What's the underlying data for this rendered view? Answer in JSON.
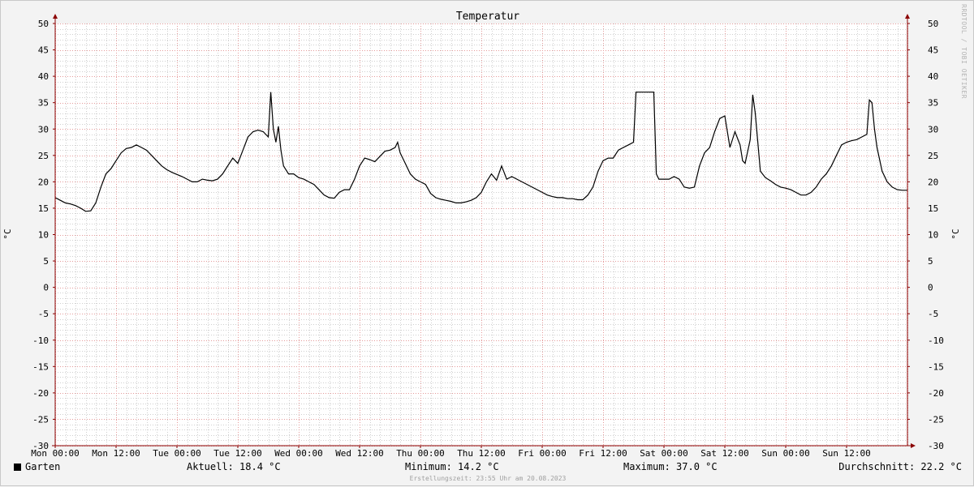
{
  "chart_data": {
    "type": "line",
    "title": "Temperatur",
    "ylabel_left": "°C",
    "ylabel_right": "°C",
    "ylim": [
      -30,
      50
    ],
    "ytick_step": 5,
    "xlim": [
      0,
      168
    ],
    "xticks": [
      {
        "h": 0,
        "label": "Mon 00:00"
      },
      {
        "h": 12,
        "label": "Mon 12:00"
      },
      {
        "h": 24,
        "label": "Tue 00:00"
      },
      {
        "h": 36,
        "label": "Tue 12:00"
      },
      {
        "h": 48,
        "label": "Wed 00:00"
      },
      {
        "h": 60,
        "label": "Wed 12:00"
      },
      {
        "h": 72,
        "label": "Thu 00:00"
      },
      {
        "h": 84,
        "label": "Thu 12:00"
      },
      {
        "h": 96,
        "label": "Fri 00:00"
      },
      {
        "h": 108,
        "label": "Fri 12:00"
      },
      {
        "h": 120,
        "label": "Sat 00:00"
      },
      {
        "h": 132,
        "label": "Sat 12:00"
      },
      {
        "h": 144,
        "label": "Sun 00:00"
      },
      {
        "h": 156,
        "label": "Sun 12:00"
      }
    ],
    "grid": true,
    "series": [
      {
        "name": "Garten",
        "color": "#000000",
        "points": [
          [
            0,
            17.0
          ],
          [
            1,
            16.5
          ],
          [
            2,
            16.0
          ],
          [
            3,
            15.8
          ],
          [
            4,
            15.5
          ],
          [
            5,
            15.0
          ],
          [
            6,
            14.4
          ],
          [
            7,
            14.5
          ],
          [
            8,
            16.0
          ],
          [
            9,
            19.0
          ],
          [
            10,
            21.5
          ],
          [
            11,
            22.5
          ],
          [
            12,
            24.0
          ],
          [
            13,
            25.5
          ],
          [
            14,
            26.3
          ],
          [
            15,
            26.5
          ],
          [
            16,
            27.0
          ],
          [
            17,
            26.5
          ],
          [
            18,
            26.0
          ],
          [
            19,
            25.0
          ],
          [
            20,
            24.0
          ],
          [
            21,
            23.0
          ],
          [
            22,
            22.3
          ],
          [
            23,
            21.8
          ],
          [
            24,
            21.4
          ],
          [
            25,
            21.0
          ],
          [
            26,
            20.5
          ],
          [
            27,
            20.0
          ],
          [
            28,
            20.0
          ],
          [
            29,
            20.5
          ],
          [
            30,
            20.3
          ],
          [
            31,
            20.2
          ],
          [
            32,
            20.5
          ],
          [
            33,
            21.5
          ],
          [
            34,
            23.0
          ],
          [
            35,
            24.5
          ],
          [
            36,
            23.5
          ],
          [
            37,
            26.0
          ],
          [
            38,
            28.5
          ],
          [
            39,
            29.5
          ],
          [
            40,
            29.8
          ],
          [
            41,
            29.5
          ],
          [
            42,
            28.5
          ],
          [
            42.5,
            37.0
          ],
          [
            43,
            30.0
          ],
          [
            43.5,
            27.5
          ],
          [
            44,
            30.5
          ],
          [
            44.5,
            26.0
          ],
          [
            45,
            23.0
          ],
          [
            46,
            21.5
          ],
          [
            47,
            21.5
          ],
          [
            48,
            20.8
          ],
          [
            49,
            20.5
          ],
          [
            50,
            20.0
          ],
          [
            51,
            19.5
          ],
          [
            52,
            18.5
          ],
          [
            53,
            17.5
          ],
          [
            54,
            17.0
          ],
          [
            55,
            16.9
          ],
          [
            56,
            18.0
          ],
          [
            57,
            18.5
          ],
          [
            58,
            18.5
          ],
          [
            59,
            20.5
          ],
          [
            60,
            23.0
          ],
          [
            61,
            24.5
          ],
          [
            62,
            24.2
          ],
          [
            63,
            23.8
          ],
          [
            64,
            24.8
          ],
          [
            65,
            25.8
          ],
          [
            66,
            26.0
          ],
          [
            67,
            26.5
          ],
          [
            67.5,
            27.5
          ],
          [
            68,
            25.5
          ],
          [
            69,
            23.5
          ],
          [
            70,
            21.5
          ],
          [
            71,
            20.5
          ],
          [
            72,
            20.0
          ],
          [
            73,
            19.5
          ],
          [
            74,
            17.8
          ],
          [
            75,
            17.0
          ],
          [
            76,
            16.7
          ],
          [
            77,
            16.5
          ],
          [
            78,
            16.3
          ],
          [
            79,
            16.0
          ],
          [
            80,
            16.0
          ],
          [
            81,
            16.2
          ],
          [
            82,
            16.5
          ],
          [
            83,
            17.0
          ],
          [
            84,
            18.0
          ],
          [
            85,
            20.0
          ],
          [
            86,
            21.5
          ],
          [
            87,
            20.3
          ],
          [
            88,
            23.0
          ],
          [
            89,
            20.5
          ],
          [
            90,
            21.0
          ],
          [
            91,
            20.5
          ],
          [
            92,
            20.0
          ],
          [
            93,
            19.5
          ],
          [
            94,
            19.0
          ],
          [
            95,
            18.5
          ],
          [
            96,
            18.0
          ],
          [
            97,
            17.5
          ],
          [
            98,
            17.2
          ],
          [
            99,
            17.0
          ],
          [
            100,
            17.0
          ],
          [
            101,
            16.8
          ],
          [
            102,
            16.8
          ],
          [
            103,
            16.6
          ],
          [
            104,
            16.6
          ],
          [
            105,
            17.5
          ],
          [
            106,
            19.0
          ],
          [
            107,
            22.0
          ],
          [
            108,
            24.0
          ],
          [
            109,
            24.5
          ],
          [
            110,
            24.5
          ],
          [
            111,
            26.0
          ],
          [
            112,
            26.5
          ],
          [
            113,
            27.0
          ],
          [
            114,
            27.5
          ],
          [
            114.5,
            37.0
          ],
          [
            118,
            37.0
          ],
          [
            118.5,
            21.5
          ],
          [
            119,
            20.5
          ],
          [
            120,
            20.5
          ],
          [
            121,
            20.5
          ],
          [
            122,
            21.0
          ],
          [
            123,
            20.5
          ],
          [
            124,
            19.0
          ],
          [
            125,
            18.8
          ],
          [
            126,
            19.0
          ],
          [
            127,
            23.0
          ],
          [
            128,
            25.5
          ],
          [
            129,
            26.5
          ],
          [
            130,
            29.5
          ],
          [
            131,
            32.0
          ],
          [
            132,
            32.5
          ],
          [
            133,
            26.5
          ],
          [
            134,
            29.5
          ],
          [
            135,
            27.0
          ],
          [
            135.5,
            24.0
          ],
          [
            136,
            23.5
          ],
          [
            137,
            28.0
          ],
          [
            137.5,
            36.5
          ],
          [
            138,
            33.0
          ],
          [
            139,
            22.0
          ],
          [
            140,
            20.8
          ],
          [
            141,
            20.2
          ],
          [
            142,
            19.5
          ],
          [
            143,
            19.0
          ],
          [
            144,
            18.8
          ],
          [
            145,
            18.5
          ],
          [
            146,
            18.0
          ],
          [
            147,
            17.5
          ],
          [
            148,
            17.5
          ],
          [
            149,
            18.0
          ],
          [
            150,
            19.0
          ],
          [
            151,
            20.5
          ],
          [
            152,
            21.5
          ],
          [
            153,
            23.0
          ],
          [
            154,
            25.0
          ],
          [
            155,
            27.0
          ],
          [
            156,
            27.5
          ],
          [
            157,
            27.8
          ],
          [
            158,
            28.0
          ],
          [
            159,
            28.5
          ],
          [
            160,
            29.0
          ],
          [
            160.5,
            35.5
          ],
          [
            161,
            35.0
          ],
          [
            161.5,
            30.0
          ],
          [
            162,
            26.5
          ],
          [
            163,
            22.0
          ],
          [
            164,
            20.0
          ],
          [
            165,
            19.0
          ],
          [
            166,
            18.5
          ],
          [
            167,
            18.4
          ],
          [
            168,
            18.4
          ]
        ]
      }
    ]
  },
  "legend": {
    "series_name": "Garten",
    "current": "Aktuell: 18.4 °C",
    "minimum": "Minimum: 14.2 °C",
    "maximum": "Maximum: 37.0 °C",
    "average": "Durchschnitt: 22.2 °C"
  },
  "footer": "Erstellungszeit: 23:55 Uhr am 20.08.2023",
  "watermark": "RRDTOOL / TOBI OETIKER",
  "colors": {
    "axis": "#8b0000",
    "major_grid": "#e59a9a",
    "minor_grid": "#cfcfcf",
    "plot_bg": "#ffffff",
    "line": "#000000"
  }
}
